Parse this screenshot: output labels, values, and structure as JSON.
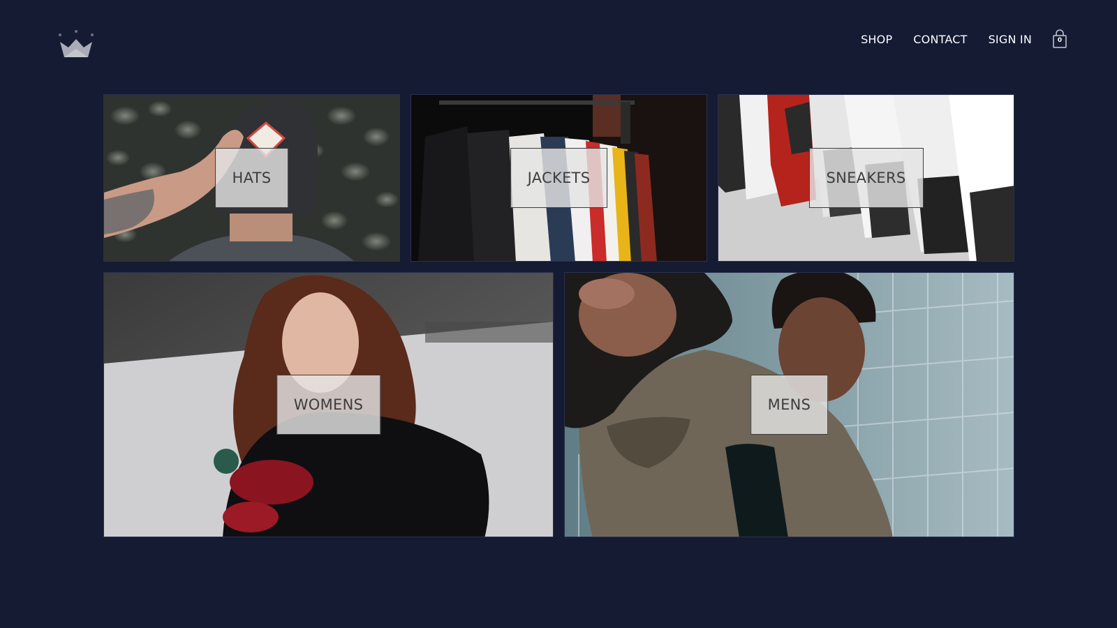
{
  "header": {
    "nav": {
      "shop": "SHOP",
      "contact": "CONTACT",
      "sign_in": "SIGN IN"
    },
    "cart_count": "0",
    "cart_icon": "shopping-bag-icon",
    "logo_icon": "crown-icon"
  },
  "directory": {
    "hats": "HATS",
    "jackets": "JACKETS",
    "sneakers": "SNEAKERS",
    "womens": "WOMENS",
    "mens": "MENS"
  },
  "colors": {
    "background": "#141b33",
    "nav_text": "#ffffff",
    "label_box": "#e4e4e4",
    "label_text": "#3d3d3d"
  }
}
